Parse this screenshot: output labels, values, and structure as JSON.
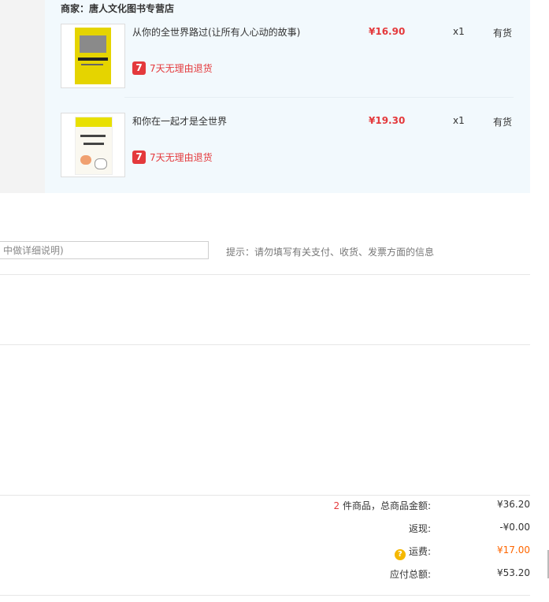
{
  "shop": {
    "label": "商家：唐人文化图书专营店",
    "items": [
      {
        "title": "从你的全世界路过(让所有人心动的故事)",
        "price": "¥16.90",
        "qty": "x1",
        "stock": "有货",
        "return_icon": "7",
        "return_text": "7天无理由退货"
      },
      {
        "title": "和你在一起才是全世界",
        "price": "¥19.30",
        "qty": "x1",
        "stock": "有货",
        "return_icon": "7",
        "return_text": "7天无理由退货"
      }
    ]
  },
  "remark": {
    "placeholder": "中做详细说明)",
    "tip": "提示：请勿填写有关支付、收货、发票方面的信息"
  },
  "summary": {
    "count": "2",
    "total_label": " 件商品，总商品金额:",
    "total_value": "¥36.20",
    "cashback_label": "返现:",
    "cashback_value": "-¥0.00",
    "shipping_icon": "?",
    "shipping_label": "运费:",
    "shipping_value": "¥17.00",
    "payable_label": "应付总额:",
    "payable_value": "¥53.20"
  },
  "colors": {
    "accent_red": "#e4393c",
    "shipping_orange": "#ff6600",
    "panel_bg": "#f2f9fd"
  }
}
